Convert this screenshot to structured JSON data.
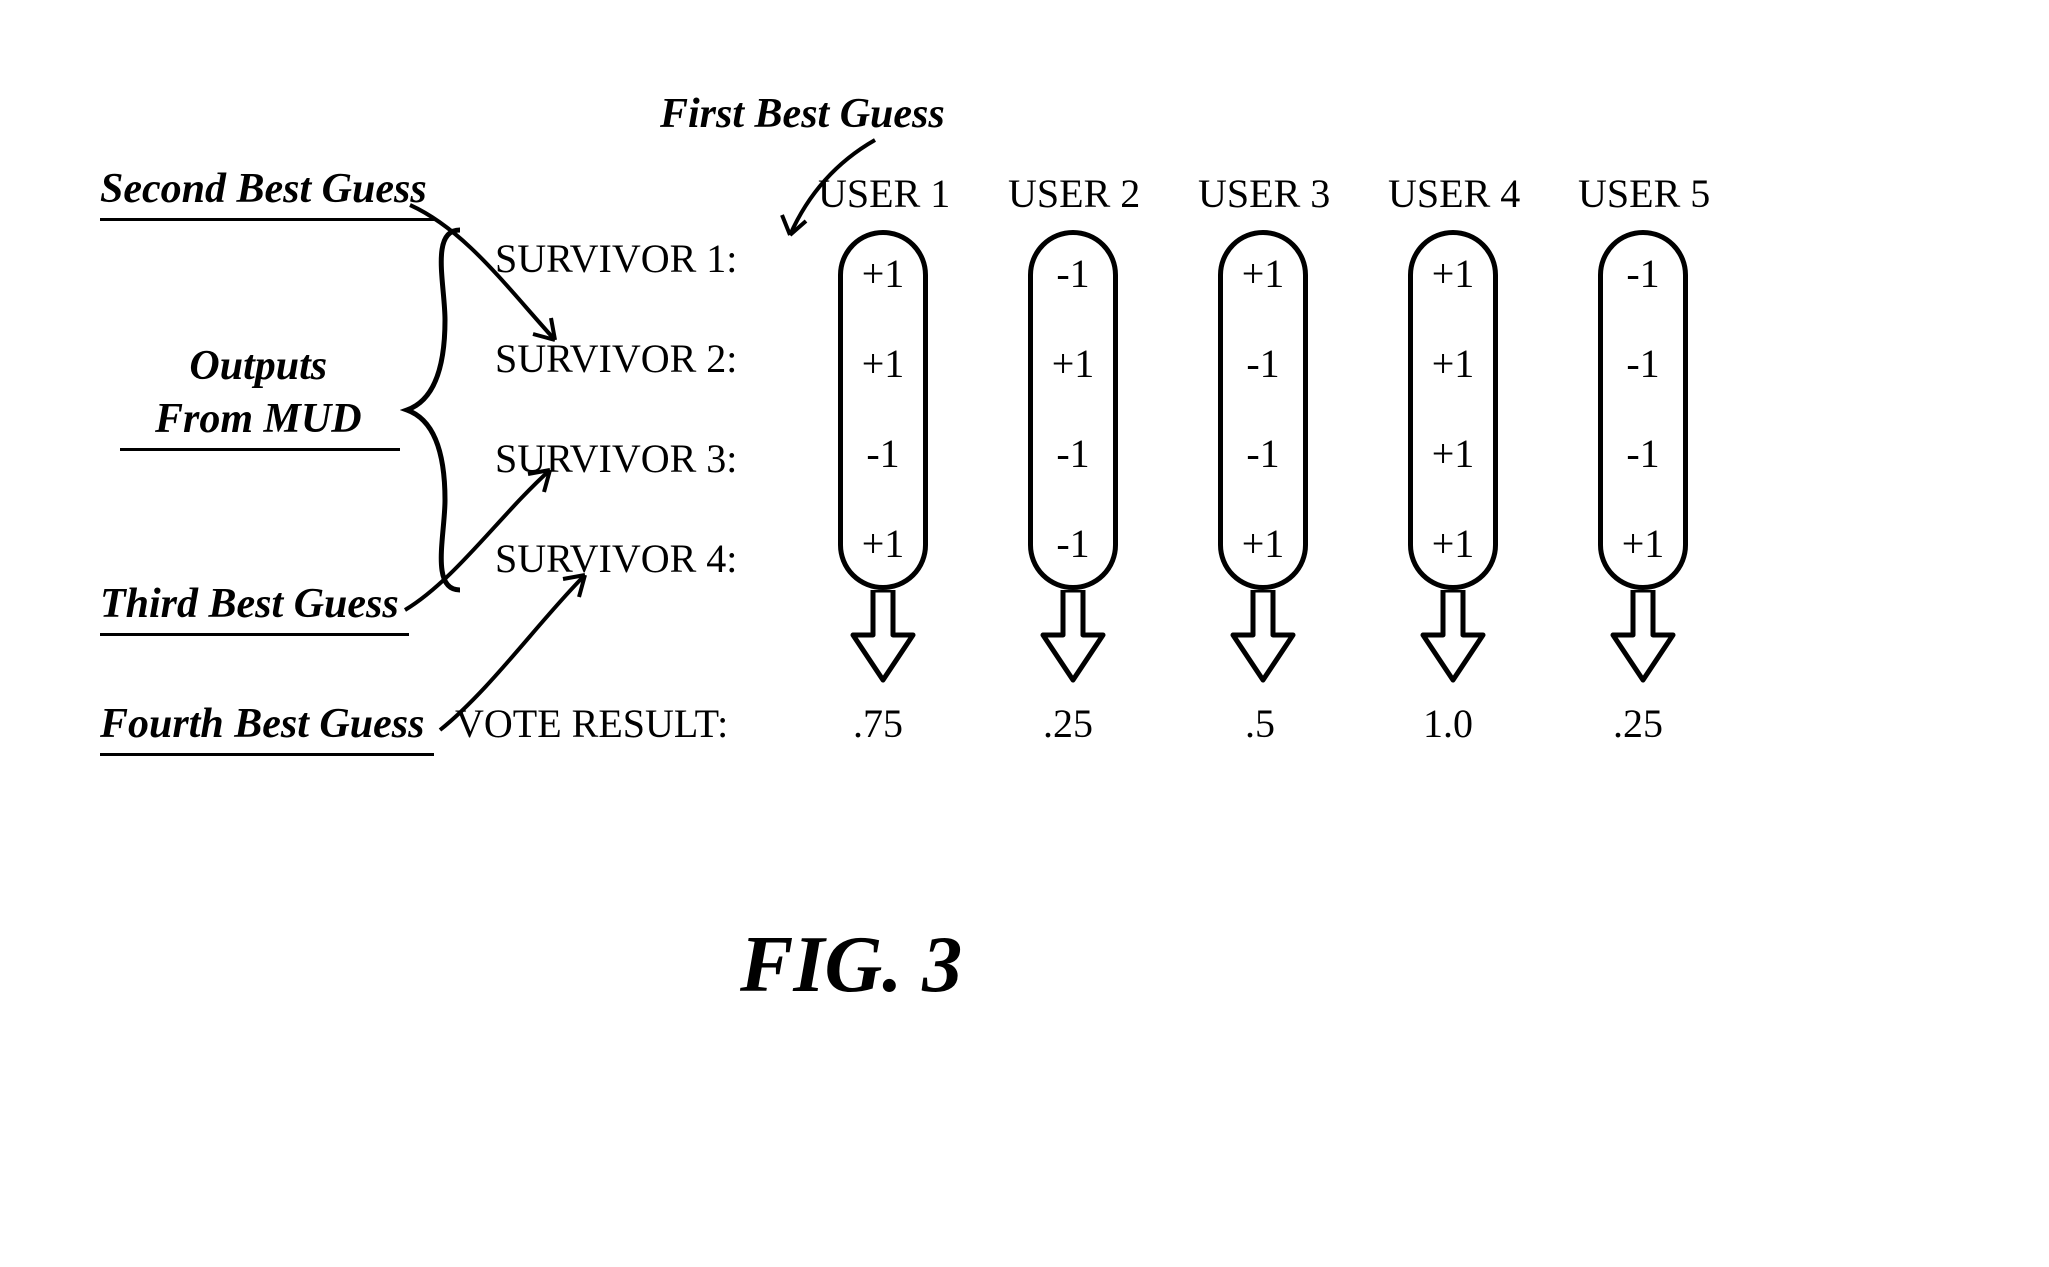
{
  "labels": {
    "first_best": "First Best Guess",
    "second_best": "Second Best Guess",
    "third_best": "Third Best Guess",
    "fourth_best": "Fourth Best Guess",
    "outputs_line1": "Outputs",
    "outputs_line2": "From MUD"
  },
  "rows": {
    "s1": "SURVIVOR 1:",
    "s2": "SURVIVOR 2:",
    "s3": "SURVIVOR 3:",
    "s4": "SURVIVOR 4:",
    "vote": "VOTE RESULT:"
  },
  "users": {
    "u1": "USER 1",
    "u2": "USER 2",
    "u3": "USER 3",
    "u4": "USER 4",
    "u5": "USER 5"
  },
  "matrix": {
    "u1": {
      "s1": "+1",
      "s2": "+1",
      "s3": "-1",
      "s4": "+1"
    },
    "u2": {
      "s1": "-1",
      "s2": "+1",
      "s3": "-1",
      "s4": "-1"
    },
    "u3": {
      "s1": "+1",
      "s2": "-1",
      "s3": "-1",
      "s4": "+1"
    },
    "u4": {
      "s1": "+1",
      "s2": "+1",
      "s3": "+1",
      "s4": "+1"
    },
    "u5": {
      "s1": "-1",
      "s2": "-1",
      "s3": "-1",
      "s4": "+1"
    }
  },
  "vote_results": {
    "u1": ".75",
    "u2": ".25",
    "u3": ".5",
    "u4": "1.0",
    "u5": ".25"
  },
  "caption": "FIG. 3"
}
